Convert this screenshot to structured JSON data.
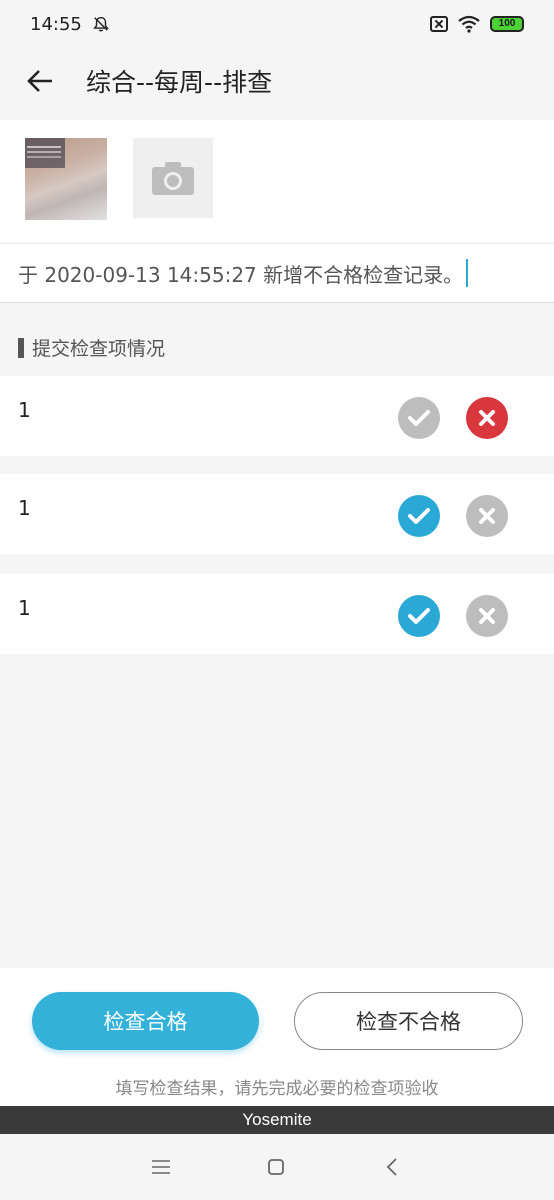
{
  "status_bar": {
    "time": "14:55",
    "battery": "100"
  },
  "header": {
    "title": "综合--每周--排查"
  },
  "record": {
    "text": "于 2020-09-13 14:55:27 新增不合格检查记录。"
  },
  "section": {
    "title": "提交检查项情况"
  },
  "items": [
    {
      "label": "1",
      "result": "fail"
    },
    {
      "label": "1",
      "result": "pass"
    },
    {
      "label": "1",
      "result": "pass"
    }
  ],
  "colors": {
    "accent": "#33b1d9",
    "check_active": "#2aa8d6",
    "cross_active": "#d9363e",
    "inactive": "#bdbdbd"
  },
  "actions": {
    "pass_label": "检查合格",
    "fail_label": "检查不合格",
    "hint": "填写检查结果，请先完成必要的检查项验收"
  },
  "device": {
    "name": "Yosemite"
  }
}
